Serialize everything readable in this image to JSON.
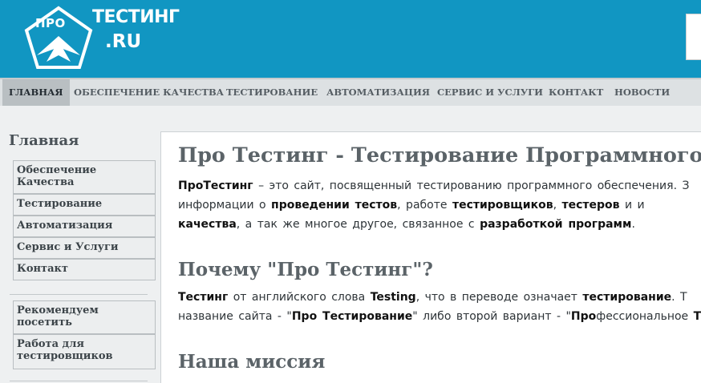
{
  "header": {
    "logo_pro": "ПРО",
    "logo_testing": "ТЕСТИНГ",
    "logo_ru": ".RU"
  },
  "nav": {
    "items": [
      {
        "label": "ГЛАВНАЯ"
      },
      {
        "label": "ОБЕСПЕЧЕНИЕ КАЧЕСТВА"
      },
      {
        "label": "ТЕСТИРОВАНИЕ"
      },
      {
        "label": "АВТОМАТИЗАЦИЯ"
      },
      {
        "label": "СЕРВИС И УСЛУГИ"
      },
      {
        "label": "КОНТАКТ"
      },
      {
        "label": "НОВОСТИ"
      }
    ]
  },
  "sidebar": {
    "title": "Главная",
    "items": [
      {
        "label_line1": "Обеспечение",
        "label_line2": "Качества"
      },
      {
        "label_line1": "Тестирование"
      },
      {
        "label_line1": "Автоматизация"
      },
      {
        "label_line1": "Сервис и Услуги"
      },
      {
        "label_line1": "Контакт"
      }
    ],
    "extra_items": [
      {
        "label_line1": "Рекомендуем",
        "label_line2": "посетить"
      },
      {
        "label_line1": "Работа для",
        "label_line2": "тестировщиков"
      }
    ]
  },
  "content": {
    "title": "Про Тестинг - Тестирование Программного О",
    "intro": {
      "l1_b1": "ПроТестинг",
      "l1_t1": " – это сайт, посвященный тестированию программного обеспечения. З",
      "l2_t1": "информации о ",
      "l2_b1": "проведении тестов",
      "l2_t2": ", работе ",
      "l2_b2": "тестировщиков",
      "l2_t3": ", ",
      "l2_b3": "тестеров",
      "l2_t4": " и и",
      "l3_b1": "качества",
      "l3_t1": ", а так же многое другое, связанное с ",
      "l3_b2": "разработкой программ",
      "l3_t2": "."
    },
    "why_title": "Почему \"Про Тестинг\"?",
    "why": {
      "l1_b1": "Тестинг",
      "l1_t1": " от английского слова ",
      "l1_b2": "Testing",
      "l1_t2": ", что в переводе означает ",
      "l1_b3": "тестирование",
      "l1_t3": ". Т",
      "l2_t1": "название сайта - \"",
      "l2_b1": "Про Тестирование",
      "l2_t2": "\" либо второй вариант - \"",
      "l2_b2": "Про",
      "l2_t3": "фессиональное ",
      "l2_b3": "Т"
    },
    "mission_title": "Наша миссия"
  },
  "colors": {
    "header_bg": "#1196c2",
    "nav_bg": "#dde1e3",
    "nav_active_bg": "#b9bfc2",
    "page_bg": "#eef0f1",
    "heading": "#5b6368"
  }
}
